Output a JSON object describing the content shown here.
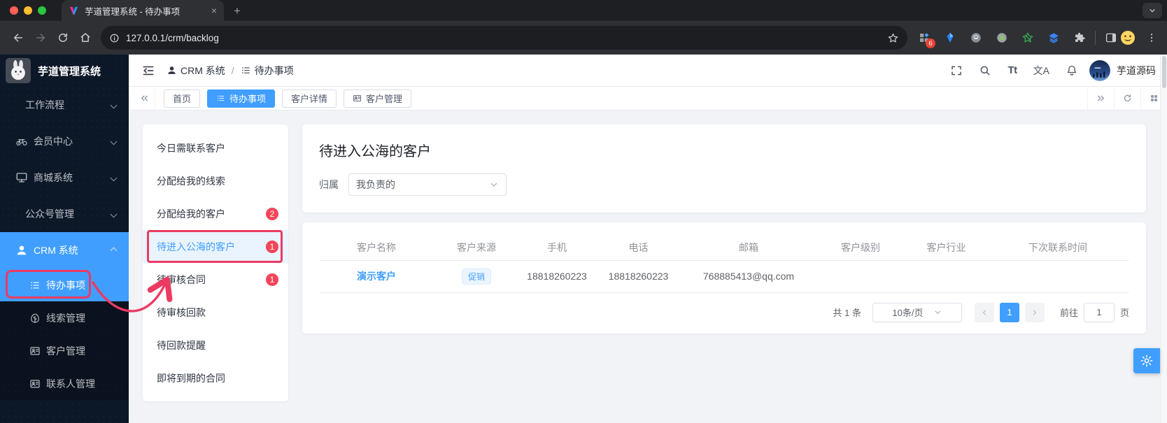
{
  "browser": {
    "tab": {
      "title": "芋道管理系统 - 待办事项",
      "close": "×"
    },
    "new_tab": "+",
    "url": "127.0.0.1/crm/backlog",
    "extensions_badge": "6"
  },
  "sidebar": {
    "logo_title": "芋道管理系统",
    "items": [
      {
        "label": "工作流程",
        "icon": "",
        "has_chevron": true,
        "chevron_up": false
      },
      {
        "label": "会员中心",
        "icon": "bike",
        "has_chevron": true,
        "chevron_up": false
      },
      {
        "label": "商城系统",
        "icon": "shop",
        "has_chevron": true,
        "chevron_up": false
      },
      {
        "label": "公众号管理",
        "icon": "",
        "has_chevron": true,
        "chevron_up": false
      },
      {
        "label": "CRM 系统",
        "icon": "user",
        "has_chevron": true,
        "chevron_up": true,
        "active": true
      },
      {
        "label": "待办事项",
        "icon": "list",
        "child": true,
        "active": true,
        "annotated": true
      },
      {
        "label": "线索管理",
        "icon": "leaf",
        "child": true
      },
      {
        "label": "客户管理",
        "icon": "idcard",
        "child": true
      },
      {
        "label": "联系人管理",
        "icon": "idcard",
        "child": true
      }
    ]
  },
  "header": {
    "breadcrumb": [
      {
        "sep": "",
        "icon": "user",
        "label": "CRM 系统"
      },
      {
        "sep": "/",
        "icon": "list",
        "label": "待办事项"
      }
    ],
    "font_size_tool_text": "Tt",
    "locale_tool_text": "文A",
    "username": "芋道源码"
  },
  "tabs": [
    {
      "label": "首页"
    },
    {
      "label": "待办事项",
      "icon": "list",
      "active": true
    },
    {
      "label": "客户详情"
    },
    {
      "label": "客户管理",
      "icon": "idcard"
    }
  ],
  "todo_menu": [
    {
      "label": "今日需联系客户"
    },
    {
      "label": "分配给我的线索"
    },
    {
      "label": "分配给我的客户",
      "badge": "2"
    },
    {
      "label": "待进入公海的客户",
      "badge": "1",
      "active": true,
      "annotated": true
    },
    {
      "label": "待审核合同",
      "badge": "1"
    },
    {
      "label": "待审核回款"
    },
    {
      "label": "待回款提醒"
    },
    {
      "label": "即将到期的合同"
    }
  ],
  "content": {
    "title": "待进入公海的客户",
    "filter": {
      "label": "归属",
      "value": "我负责的"
    },
    "table": {
      "headers": [
        "客户名称",
        "客户来源",
        "手机",
        "电话",
        "邮箱",
        "客户级别",
        "客户行业",
        "下次联系时间"
      ],
      "rows": [
        {
          "name": "演示客户",
          "source": "促销",
          "mobile": "18818260223",
          "phone": "18818260223",
          "email": "768885413@qq.com",
          "level": "",
          "industry": "",
          "next_time": ""
        }
      ]
    },
    "pagination": {
      "total": "共 1 条",
      "page_size": "10条/页",
      "page": "1",
      "goto_label": "前往",
      "goto_value": "1",
      "unit": "页"
    }
  }
}
